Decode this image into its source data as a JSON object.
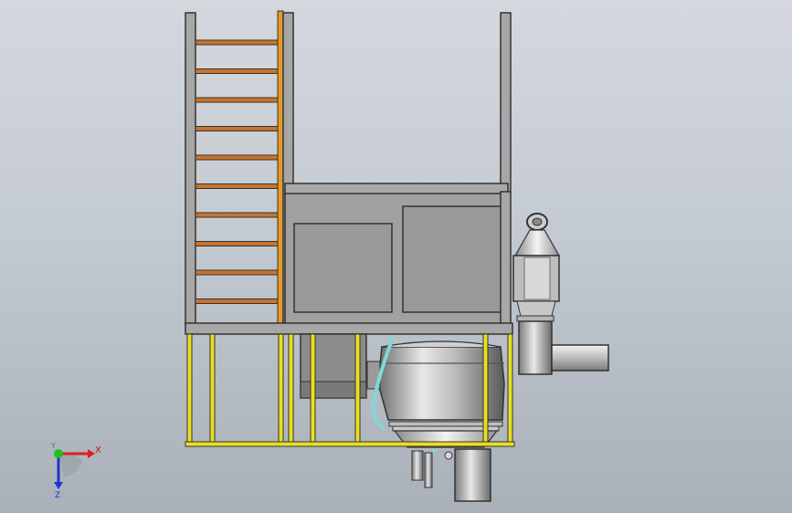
{
  "triad": {
    "x_label": "X",
    "y_label": "Y",
    "z_label": "Z"
  },
  "colors": {
    "background_top": "#d4d8de",
    "background_bottom": "#a9b0b8",
    "steel_gray": "#a7a7a7",
    "panel_gray": "#9a9a9a",
    "ladder_rung_orange": "#c8742c",
    "ladder_rail_orange": "#e59a25",
    "railing_yellow": "#e8e01e",
    "hopper_silver": "#b9b9b9",
    "cyan_pipe": "#7fd8d8",
    "triad_x": "#e02020",
    "triad_y": "#20c020",
    "triad_z": "#2030d0"
  },
  "model": {
    "view": "front-orthographic",
    "components": [
      "steel-frame",
      "ladder",
      "control-cabinet",
      "safety-railing",
      "conical-hopper",
      "cyclone-separator",
      "outlet-pipe",
      "discharge-spout"
    ],
    "ladder_rungs": 10
  }
}
